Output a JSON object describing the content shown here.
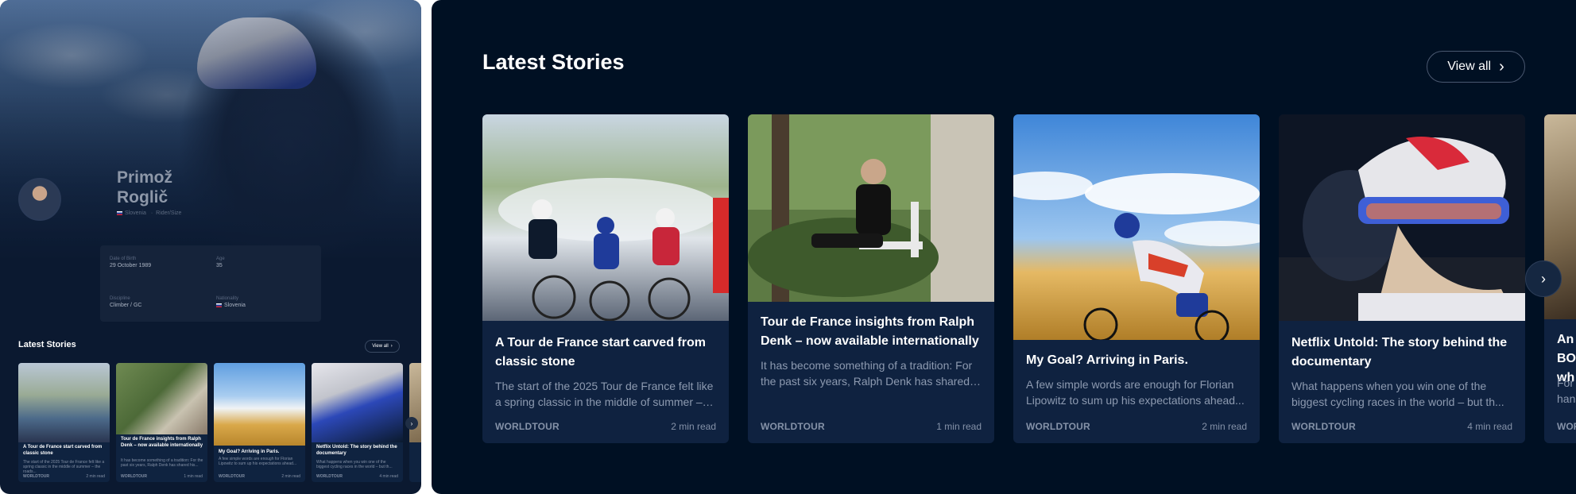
{
  "left_panel": {
    "athlete": {
      "first_name": "Primož",
      "last_name": "Roglič",
      "meta_nation": "Slovenia",
      "meta_role": "Rider/Size"
    },
    "stats": [
      {
        "label": "Date of Birth",
        "value": "29 October 1989"
      },
      {
        "label": "Age",
        "value": "35"
      },
      {
        "label": "Discipline",
        "value": "Climber / GC"
      },
      {
        "label": "Nationality",
        "value": "Slovenia"
      }
    ],
    "section_title": "Latest Stories",
    "view_all_label": "View all"
  },
  "section": {
    "title": "Latest Stories",
    "view_all_label": "View all"
  },
  "cards": [
    {
      "title": "A Tour de France start carved from classic stone",
      "excerpt": "The start of the 2025 Tour de France felt like a spring classic in the middle of summer – the roads...",
      "category": "WORLDTOUR",
      "read_time": "2 min read"
    },
    {
      "title": "Tour de France insights from Ralph Denk – now available internationally",
      "excerpt": "It has become something of a tradition: For the past six years, Ralph Denk has shared his...",
      "category": "WORLDTOUR",
      "read_time": "1 min read"
    },
    {
      "title": "My Goal? Arriving in Paris.",
      "excerpt": "A few simple words are enough for Florian Lipowitz to sum up his expectations ahead...",
      "category": "WORLDTOUR",
      "read_time": "2 min read"
    },
    {
      "title": "Netflix Untold: The story behind the documentary",
      "excerpt": "What happens when you win one of the biggest cycling races in the world – but th...",
      "category": "WORLDTOUR",
      "read_time": "4 min read"
    }
  ],
  "peek_card": {
    "title": "An BO wh",
    "excerpt": "For hans",
    "category": "WOR"
  }
}
